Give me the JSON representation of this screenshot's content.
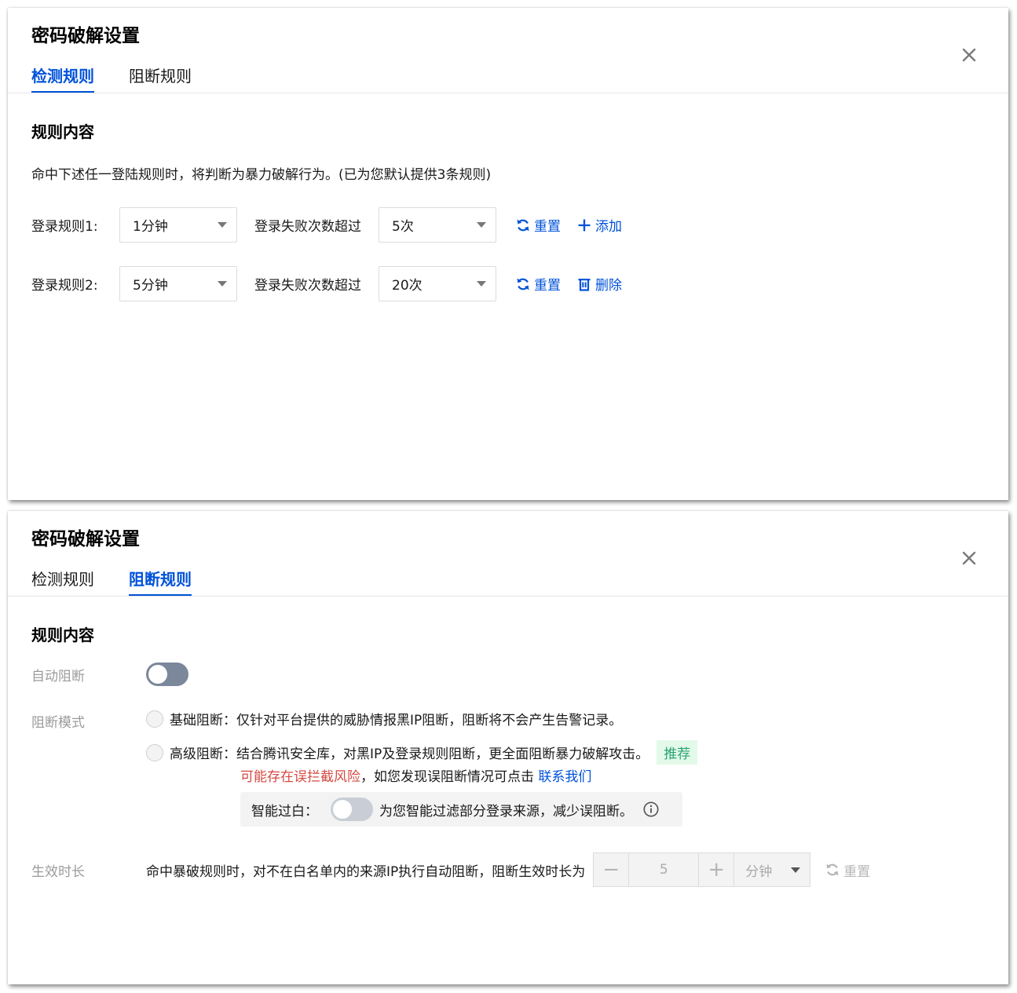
{
  "panel1": {
    "title": "密码破解设置",
    "tabs": [
      {
        "label": "检测规则",
        "active": true
      },
      {
        "label": "阻断规则",
        "active": false
      }
    ],
    "section_title": "规则内容",
    "description": "命中下述任一登陆规则时，将判断为暴力破解行为。(已为您默认提供3条规则)",
    "rules": [
      {
        "label": "登录规则1:",
        "time": "1分钟",
        "fail_label": "登录失败次数超过",
        "count": "5次",
        "reset": "重置",
        "action": "添加",
        "action_icon": "plus-icon"
      },
      {
        "label": "登录规则2:",
        "time": "5分钟",
        "fail_label": "登录失败次数超过",
        "count": "20次",
        "reset": "重置",
        "action": "删除",
        "action_icon": "trash-icon"
      }
    ]
  },
  "panel2": {
    "title": "密码破解设置",
    "tabs": [
      {
        "label": "检测规则",
        "active": false
      },
      {
        "label": "阻断规则",
        "active": true
      }
    ],
    "section_title": "规则内容",
    "auto_block_label": "自动阻断",
    "auto_block_on": false,
    "mode_label": "阻断模式",
    "mode_basic": "基础阻断：仅针对平台提供的威胁情报黑IP阻断，阻断将不会产生告警记录。",
    "mode_advanced": "高级阻断：结合腾讯安全库，对黑IP及登录规则阻断，更全面阻断暴力破解攻击。",
    "recommend_tag": "推荐",
    "risk_warning": "可能存在误拦截风险",
    "risk_suffix": "，如您发现误阻断情况可点击 ",
    "contact_link": "联系我们",
    "smart_whitelist_label": "智能过白：",
    "smart_whitelist_desc": "为您智能过滤部分登录来源，减少误阻断。",
    "duration_label": "生效时长",
    "duration_desc": "命中暴破规则时，对不在白名单内的来源IP执行自动阻断，阻断生效时长为",
    "duration_value": "5",
    "duration_unit": "分钟",
    "minus": "−",
    "plus": "+",
    "reset": "重置"
  },
  "colors": {
    "brand": "#0052d9",
    "warning": "#d54941",
    "success": "#2ba471"
  }
}
